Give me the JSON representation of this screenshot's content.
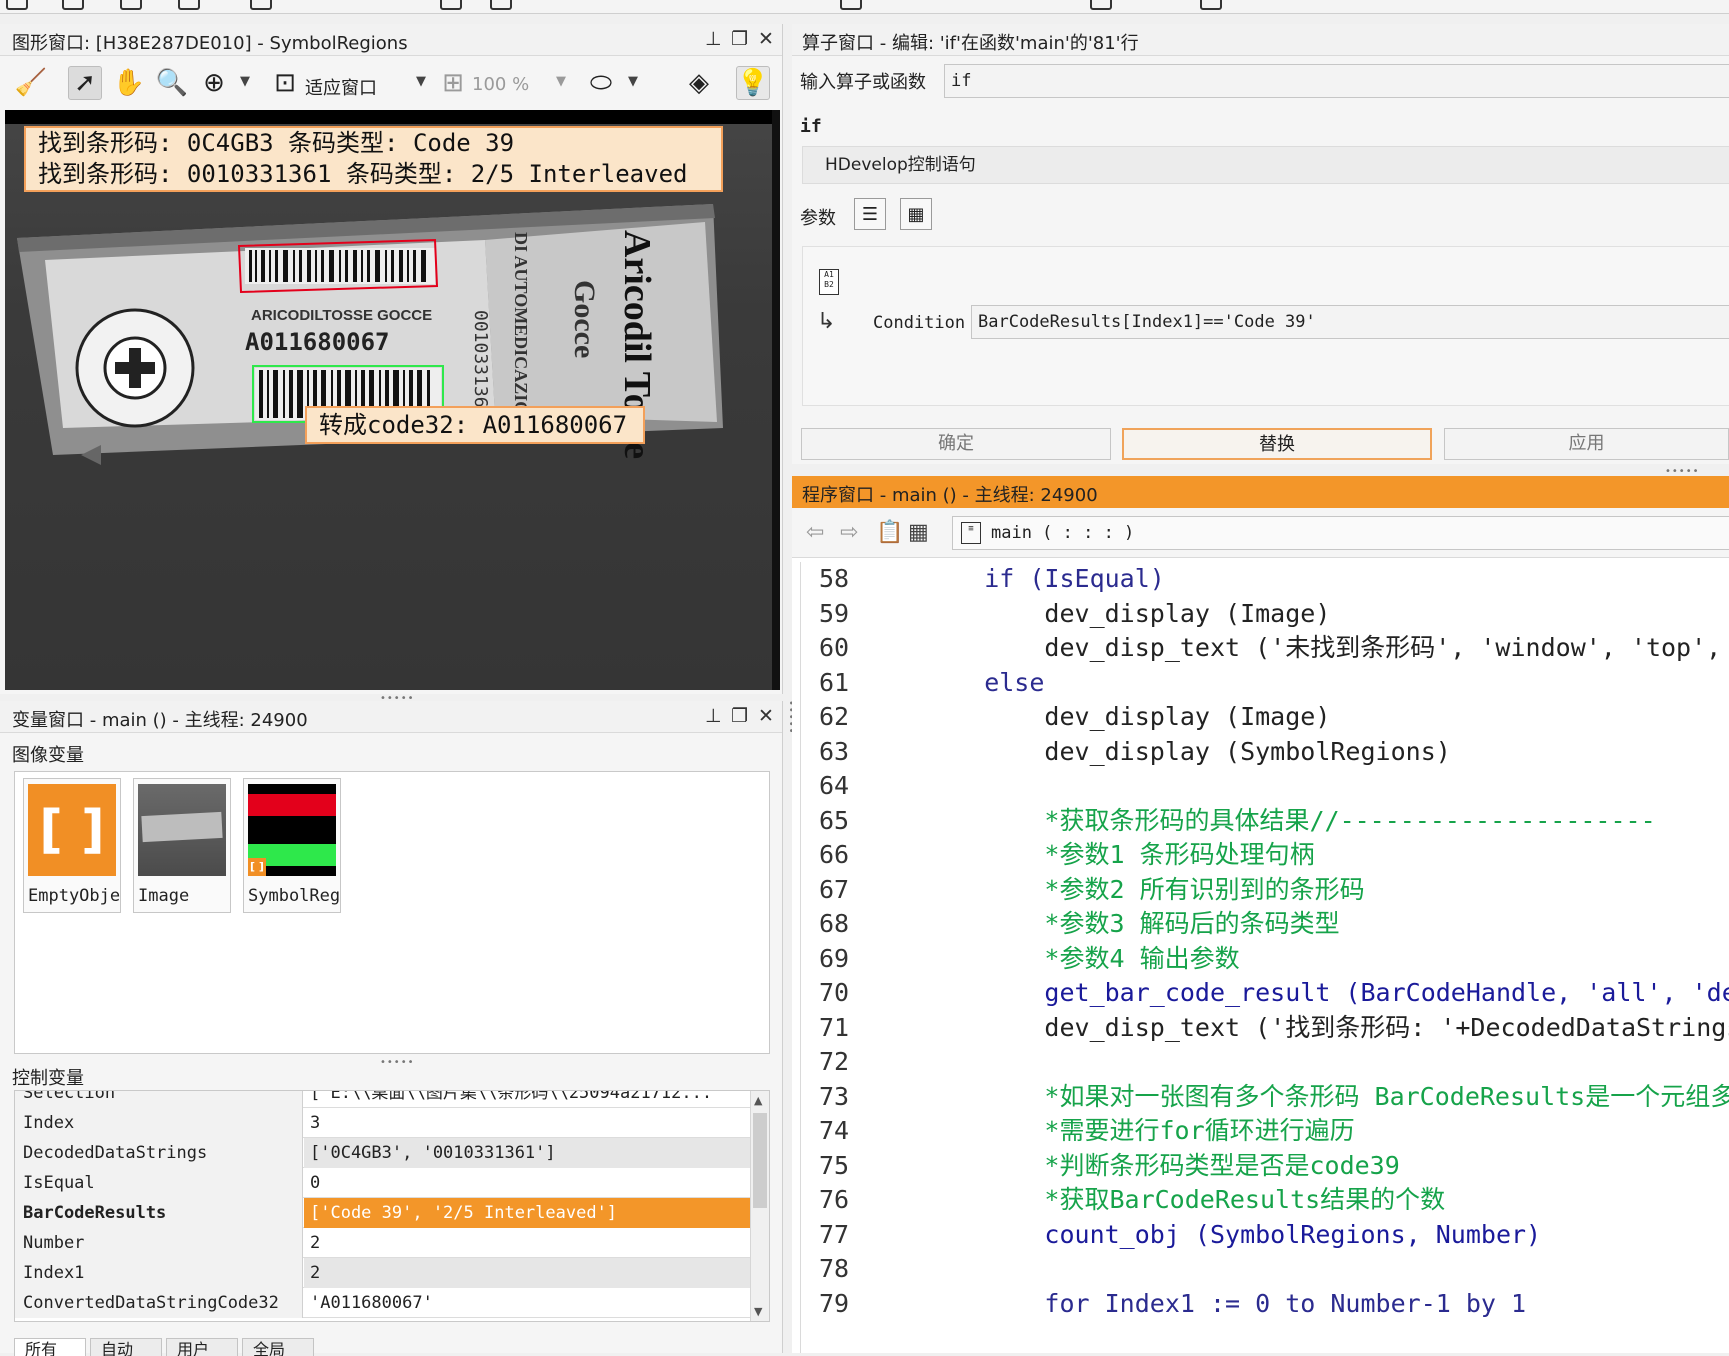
{
  "graphics_window": {
    "title": "图形窗口: [H38E287DE010] - SymbolRegions",
    "fit_window_label": "适应窗口",
    "zoom_label": "100 %",
    "overlay_lines": [
      "找到条形码: 0C4GB3 条码类型: Code 39",
      "找到条形码: 0010331361 条码类型: 2/5 Interleaved"
    ],
    "code32_label": "转成code32: A011680067"
  },
  "variable_window": {
    "title": "变量窗口 - main () - 主线程: 24900",
    "image_vars_label": "图像变量",
    "image_vars": [
      {
        "name": "EmptyObjec"
      },
      {
        "name": "Image"
      },
      {
        "name": "SymbolRegi"
      }
    ],
    "control_vars_label": "控制变量",
    "control_vars": [
      {
        "name": "Selection",
        "value": "['E:\\\\桌面\\\\图片集\\\\条形码\\\\25094a21712...",
        "style": "normal"
      },
      {
        "name": "Index",
        "value": "3",
        "style": "normal"
      },
      {
        "name": "DecodedDataStrings",
        "value": "['0C4GB3', '0010331361']",
        "style": "alt"
      },
      {
        "name": "IsEqual",
        "value": "0",
        "style": "normal"
      },
      {
        "name": "BarCodeResults",
        "value": "['Code 39', '2/5 Interleaved']",
        "style": "highlight"
      },
      {
        "name": "Number",
        "value": "2",
        "style": "normal"
      },
      {
        "name": "Index1",
        "value": "2",
        "style": "alt"
      },
      {
        "name": "ConvertedDataStringCode32",
        "value": "'A011680067'",
        "style": "normal"
      }
    ],
    "tabs": [
      "所有",
      "自动",
      "用户",
      "全局"
    ]
  },
  "operator_window": {
    "title": "算子窗口 - 编辑: 'if'在函数'main'的'81'行",
    "input_label": "输入算子或函数",
    "input_value": "if",
    "operator_name": "if",
    "description": "HDevelop控制语句",
    "params_label": "参数",
    "condition_label": "Condition",
    "condition_value": "BarCodeResults[Index1]=='Code 39'",
    "buttons": {
      "ok": "确定",
      "replace": "替换",
      "apply": "应用"
    }
  },
  "program_window": {
    "title": "程序窗口 - main () - 主线程: 24900",
    "procedure_label": "main ( : : : )",
    "lines": [
      {
        "n": "58",
        "parts": [
          {
            "t": "    if (IsEqual)",
            "s": "kw"
          }
        ]
      },
      {
        "n": "59",
        "parts": [
          {
            "t": "        dev_display (Image)",
            "s": "dark"
          }
        ]
      },
      {
        "n": "60",
        "parts": [
          {
            "t": "        dev_disp_text ('未找到条形码', 'window', 'top', '",
            "s": "dark"
          }
        ]
      },
      {
        "n": "61",
        "parts": [
          {
            "t": "    else",
            "s": "kw"
          }
        ]
      },
      {
        "n": "62",
        "parts": [
          {
            "t": "        dev_display (Image)",
            "s": "dark"
          }
        ]
      },
      {
        "n": "63",
        "parts": [
          {
            "t": "        dev_display (SymbolRegions)",
            "s": "dark"
          }
        ]
      },
      {
        "n": "64",
        "parts": [
          {
            "t": "",
            "s": "dark"
          }
        ]
      },
      {
        "n": "65",
        "parts": [
          {
            "t": "        *获取条形码的具体结果//---------------------",
            "s": "cm"
          }
        ]
      },
      {
        "n": "66",
        "parts": [
          {
            "t": "        *参数1 条形码处理句柄",
            "s": "cm"
          }
        ]
      },
      {
        "n": "67",
        "parts": [
          {
            "t": "        *参数2 所有识别到的条形码",
            "s": "cm"
          }
        ]
      },
      {
        "n": "68",
        "parts": [
          {
            "t": "        *参数3 解码后的条码类型",
            "s": "cm"
          }
        ]
      },
      {
        "n": "69",
        "parts": [
          {
            "t": "        *参数4 输出参数",
            "s": "cm"
          }
        ]
      },
      {
        "n": "70",
        "parts": [
          {
            "t": "        get_bar_code_result (BarCodeHandle, 'all', 'deco",
            "s": "op"
          }
        ]
      },
      {
        "n": "71",
        "parts": [
          {
            "t": "        dev_disp_text ('找到条形码: '+DecodedDataStrings",
            "s": "dark"
          }
        ]
      },
      {
        "n": "72",
        "parts": [
          {
            "t": "",
            "s": "dark"
          }
        ]
      },
      {
        "n": "73",
        "parts": [
          {
            "t": "        *如果对一张图有多个条形码 BarCodeResults是一个元组多",
            "s": "cm"
          }
        ]
      },
      {
        "n": "74",
        "parts": [
          {
            "t": "        *需要进行for循环进行遍历",
            "s": "cm"
          }
        ]
      },
      {
        "n": "75",
        "parts": [
          {
            "t": "        *判断条形码类型是否是code39",
            "s": "cm"
          }
        ]
      },
      {
        "n": "76",
        "parts": [
          {
            "t": "        *获取BarCodeResults结果的个数",
            "s": "cm"
          }
        ]
      },
      {
        "n": "77",
        "parts": [
          {
            "t": "        count_obj (SymbolRegions, Number)",
            "s": "op"
          }
        ]
      },
      {
        "n": "78",
        "parts": [
          {
            "t": "",
            "s": "dark"
          }
        ]
      },
      {
        "n": "79",
        "parts": [
          {
            "t": "        for Index1 := 0 to Number-1 by 1",
            "s": "kw"
          }
        ]
      }
    ]
  },
  "colors": {
    "accent_orange": "#f39629",
    "comment_green": "#16a34a",
    "keyword_blue": "#2b2b8f"
  }
}
